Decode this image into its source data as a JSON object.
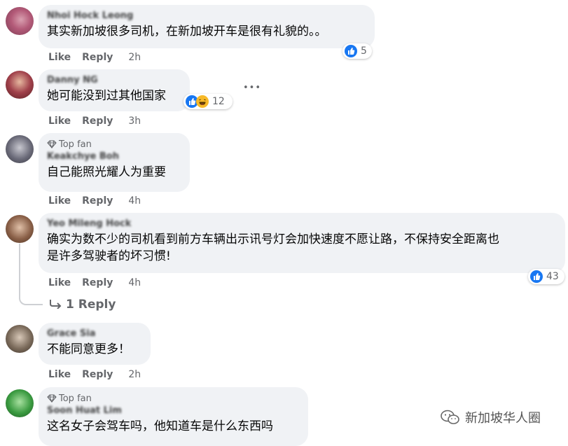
{
  "comments": [
    {
      "name": "Nhoi Hock Leong",
      "text": "其实新加坡很多司机，在新加坡开车是很有礼貌的。。",
      "like": "Like",
      "reply": "Reply",
      "time": "2h",
      "reaction_count": "5"
    },
    {
      "name": "Danny NG",
      "text": "她可能没到过其他国家",
      "like": "Like",
      "reply": "Reply",
      "time": "3h",
      "reaction_count": "12"
    },
    {
      "badge": "Top fan",
      "name": "Keakchye Boh",
      "text": "自己能照光耀人为重要",
      "like": "Like",
      "reply": "Reply",
      "time": "4h"
    },
    {
      "name": "Yeo Mileng Hock",
      "text_line1": "确实为数不少的司机看到前方车辆出示讯号灯会加快速度不愿让路，不保持安全距离也",
      "text_line2": "是许多驾驶者的坏习惯!",
      "like": "Like",
      "reply": "Reply",
      "time": "4h",
      "reaction_count": "43",
      "replies_label": "1 Reply"
    },
    {
      "name": "Grace Sia",
      "text": "不能同意更多！",
      "like": "Like",
      "reply": "Reply",
      "time": "2h"
    },
    {
      "badge": "Top fan",
      "name": "Soon Huat Lim",
      "text": "这名女子会驾车吗，他知道车是什么东西吗"
    }
  ],
  "more_options": "•••",
  "watermark": "新加坡华人圈",
  "colors": {
    "like_blue": "#1877f2",
    "bubble_bg": "#f0f2f5",
    "meta_gray": "#65676b"
  }
}
